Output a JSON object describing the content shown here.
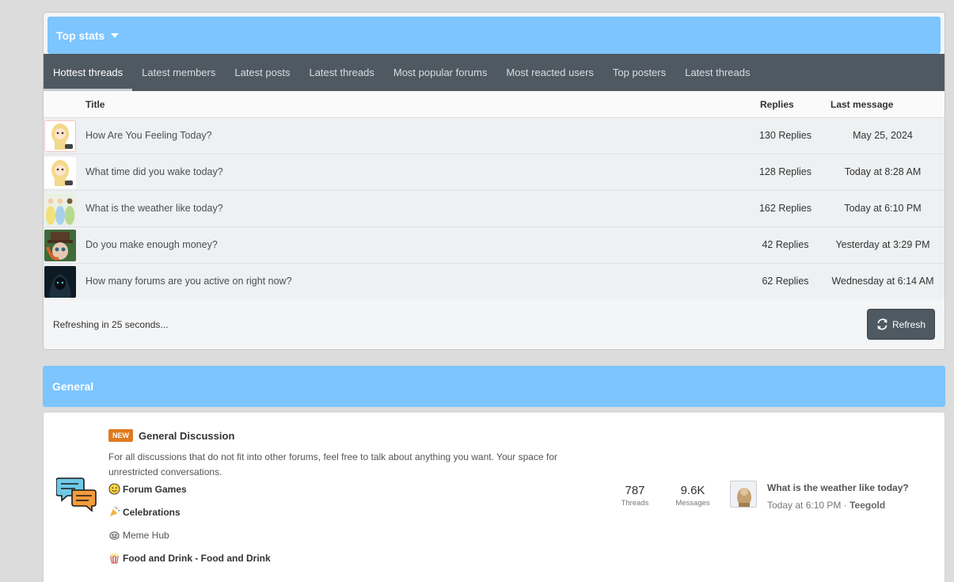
{
  "top_stats": {
    "title": "Top stats",
    "tabs": [
      "Hottest threads",
      "Latest members",
      "Latest posts",
      "Latest threads",
      "Most popular forums",
      "Most reacted users",
      "Top posters",
      "Latest threads"
    ],
    "columns": {
      "title": "Title",
      "replies": "Replies",
      "last_message": "Last message"
    },
    "rows": [
      {
        "title": "How Are You Feeling Today?",
        "replies": "130 Replies",
        "last": "May 25, 2024",
        "avatar": "cartoon-girl-avatar"
      },
      {
        "title": "What time did you wake today?",
        "replies": "128 Replies",
        "last": "Today at 8:28 AM",
        "avatar": "cartoon-girl-avatar"
      },
      {
        "title": "What is the weather like today?",
        "replies": "162 Replies",
        "last": "Today at 6:10 PM",
        "avatar": "princesses-avatar"
      },
      {
        "title": "Do you make enough money?",
        "replies": "42 Replies",
        "last": "Yesterday at 3:29 PM",
        "avatar": "mad-hatter-avatar"
      },
      {
        "title": "How many forums are you active on right now?",
        "replies": "62 Replies",
        "last": "Wednesday at 6:14 AM",
        "avatar": "dark-figure-avatar"
      }
    ],
    "refreshing_text": "Refreshing in 25 seconds...",
    "refresh_label": "Refresh"
  },
  "general": {
    "title": "General",
    "forum": {
      "badge": "NEW",
      "title": "General Discussion",
      "description": "For all discussions that do not fit into other forums, feel free to talk about anything you want. Your space for unrestricted conversations.",
      "subforums": [
        {
          "label": "Forum Games",
          "icon": "smiley-icon"
        },
        {
          "label": "Celebrations",
          "icon": "party-popper-icon"
        },
        {
          "label": "Meme Hub",
          "icon": "meme-icon"
        },
        {
          "label": "Food and Drink - Food and Drink",
          "icon": "popcorn-icon"
        }
      ],
      "threads_value": "787",
      "threads_label": "Threads",
      "messages_value": "9.6K",
      "messages_label": "Messages",
      "last_post_title": "What is the weather like today?",
      "last_post_time": "Today at 6:10 PM",
      "last_post_sep": "·",
      "last_post_user": "Teegold"
    }
  },
  "colors": {
    "header_blue": "#7cc5ff",
    "tab_bar": "#4f5962",
    "badge_orange": "#e07a1f"
  }
}
